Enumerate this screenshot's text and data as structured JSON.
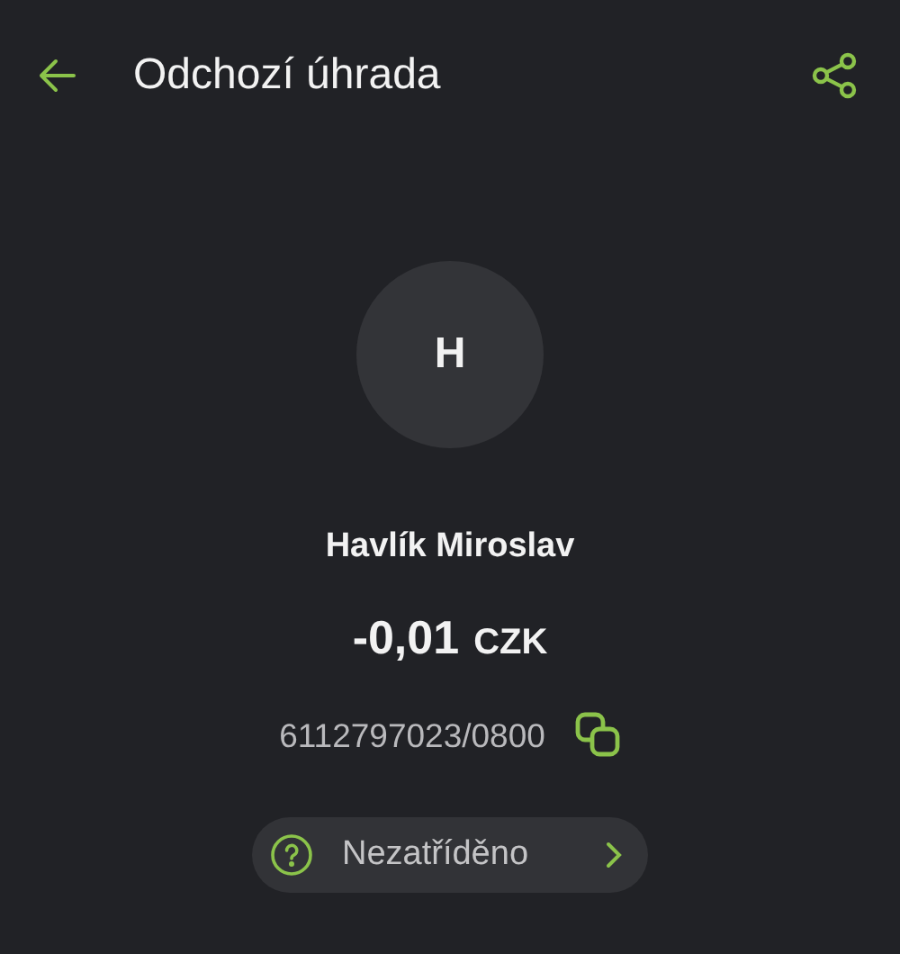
{
  "header": {
    "title": "Odchozí úhrada"
  },
  "counterparty": {
    "initial": "H",
    "name": "Havlík Miroslav"
  },
  "amount": {
    "value": "-0,01",
    "currency": "CZK"
  },
  "account": {
    "number": "6112797023/0800"
  },
  "category": {
    "label": "Nezatříděno"
  }
}
